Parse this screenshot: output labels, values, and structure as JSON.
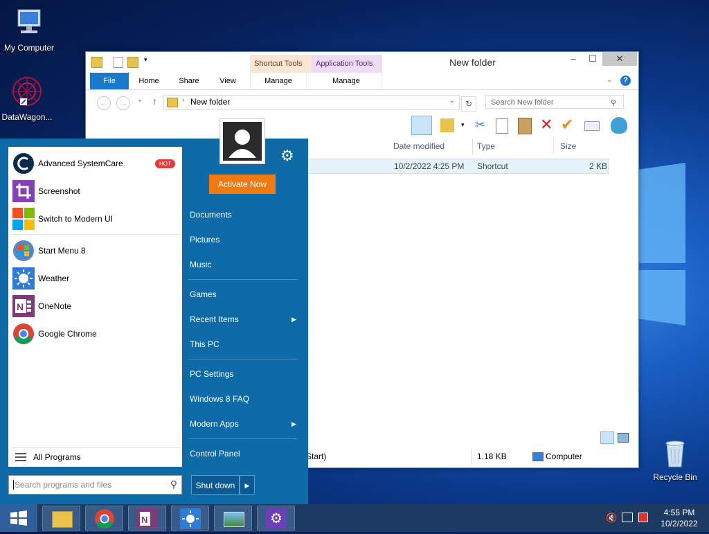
{
  "desktop": {
    "icons": [
      {
        "label": "My Computer"
      },
      {
        "label": "DataWagon..."
      },
      {
        "label": "Recycle Bin"
      }
    ]
  },
  "explorer": {
    "title": "New folder",
    "context_tabs": [
      "Shortcut Tools",
      "Application Tools"
    ],
    "ribbon_tabs": [
      "File",
      "Home",
      "Share",
      "View",
      "Manage",
      "Manage"
    ],
    "address_path": "New folder",
    "search_placeholder": "Search New folder",
    "columns": [
      "Date modified",
      "Type",
      "Size"
    ],
    "row": {
      "date": "10/2/2022 4:25 PM",
      "type": "Shortcut",
      "size": "2 KB"
    },
    "status": {
      "left": "Start)",
      "size": "1.18 KB",
      "location": "Computer"
    }
  },
  "start_menu": {
    "pinned": [
      {
        "label": "Advanced SystemCare",
        "badge": "HOT"
      },
      {
        "label": "Screenshot"
      },
      {
        "label": "Switch to Modern UI"
      }
    ],
    "recent": [
      {
        "label": "Start Menu 8"
      },
      {
        "label": "Weather"
      },
      {
        "label": "OneNote"
      },
      {
        "label": "Google Chrome"
      }
    ],
    "all_programs": "All Programs",
    "search_placeholder": "Search programs and files",
    "activate": "Activate Now",
    "links": {
      "documents": "Documents",
      "pictures": "Pictures",
      "music": "Music",
      "games": "Games",
      "recent_items": "Recent Items",
      "this_pc": "This PC",
      "pc_settings": "PC Settings",
      "win8_faq": "Windows 8 FAQ",
      "modern_apps": "Modern Apps",
      "control_panel": "Control Panel"
    },
    "shutdown": "Shut down"
  },
  "taskbar": {
    "time": "4:55 PM",
    "date": "10/2/2022"
  },
  "colors": {
    "start_blue": "#0f6aa8",
    "accent_orange": "#f07a12",
    "file_tab": "#1979ca",
    "taskbar": "#1d3a63"
  }
}
